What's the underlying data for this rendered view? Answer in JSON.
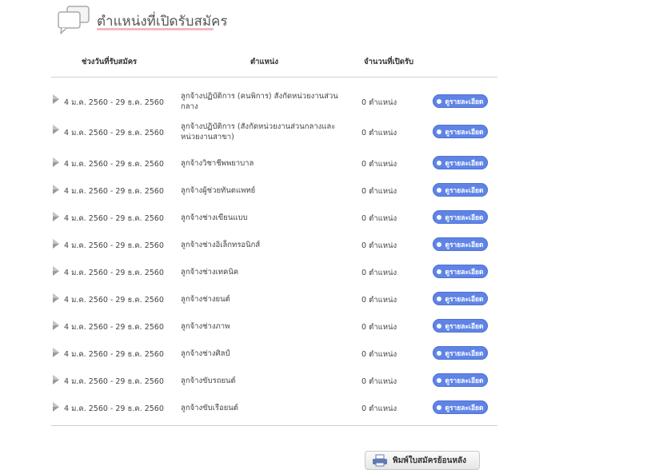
{
  "header": {
    "icon": "speech-bubbles-icon",
    "title": "ตำแหน่งที่เปิดรับสมัคร",
    "underline_color": "#f2b8c2"
  },
  "table": {
    "columns": {
      "period": "ช่วงวันที่รับสมัคร",
      "position": "ตำแหน่ง",
      "openings": "จำนวนที่เปิดรับ"
    },
    "rows": [
      {
        "period": "4 ม.ค. 2560 - 29 ธ.ค. 2560",
        "position": "ลูกจ้างปฏิบัติการ (คนพิการ) สังกัดหน่วยงานส่วนกลาง",
        "openings": "0 ตำแหน่ง",
        "detail": "ดูรายละเอียด"
      },
      {
        "period": "4 ม.ค. 2560 - 29 ธ.ค. 2560",
        "position": "ลูกจ้างปฏิบัติการ (สังกัดหน่วยงานส่วนกลางและหน่วยงานสาขา)",
        "openings": "0 ตำแหน่ง",
        "detail": "ดูรายละเอียด"
      },
      {
        "period": "4 ม.ค. 2560 - 29 ธ.ค. 2560",
        "position": "ลูกจ้างวิชาชีพพยาบาล",
        "openings": "0 ตำแหน่ง",
        "detail": "ดูรายละเอียด"
      },
      {
        "period": "4 ม.ค. 2560 - 29 ธ.ค. 2560",
        "position": "ลูกจ้างผู้ช่วยทันตแพทย์",
        "openings": "0 ตำแหน่ง",
        "detail": "ดูรายละเอียด"
      },
      {
        "period": "4 ม.ค. 2560 - 29 ธ.ค. 2560",
        "position": "ลูกจ้างช่างเขียนแบบ",
        "openings": "0 ตำแหน่ง",
        "detail": "ดูรายละเอียด"
      },
      {
        "period": "4 ม.ค. 2560 - 29 ธ.ค. 2560",
        "position": "ลูกจ้างช่างอิเล็กทรอนิกส์",
        "openings": "0 ตำแหน่ง",
        "detail": "ดูรายละเอียด"
      },
      {
        "period": "4 ม.ค. 2560 - 29 ธ.ค. 2560",
        "position": "ลูกจ้างช่างเทคนิค",
        "openings": "0 ตำแหน่ง",
        "detail": "ดูรายละเอียด"
      },
      {
        "period": "4 ม.ค. 2560 - 29 ธ.ค. 2560",
        "position": "ลูกจ้างช่างยนต์",
        "openings": "0 ตำแหน่ง",
        "detail": "ดูรายละเอียด"
      },
      {
        "period": "4 ม.ค. 2560 - 29 ธ.ค. 2560",
        "position": "ลูกจ้างช่างภาพ",
        "openings": "0 ตำแหน่ง",
        "detail": "ดูรายละเอียด"
      },
      {
        "period": "4 ม.ค. 2560 - 29 ธ.ค. 2560",
        "position": "ลูกจ้างช่างศิลป์",
        "openings": "0 ตำแหน่ง",
        "detail": "ดูรายละเอียด"
      },
      {
        "period": "4 ม.ค. 2560 - 29 ธ.ค. 2560",
        "position": "ลูกจ้างขับรถยนต์",
        "openings": "0 ตำแหน่ง",
        "detail": "ดูรายละเอียด"
      },
      {
        "period": "4 ม.ค. 2560 - 29 ธ.ค. 2560",
        "position": "ลูกจ้างขับเรือยนต์",
        "openings": "0 ตำแหน่ง",
        "detail": "ดูรายละเอียด"
      }
    ]
  },
  "footer": {
    "print_label": "พิมพ์ใบสมัครย้อนหลัง",
    "print_icon": "printer-icon"
  },
  "colors": {
    "detail_button": "#5f84e6",
    "rule": "#cfcfcf"
  }
}
